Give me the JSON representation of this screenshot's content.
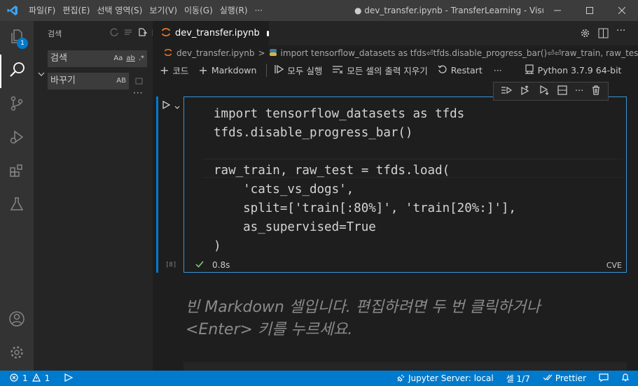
{
  "titlebar": {
    "menus": [
      "파일(F)",
      "편집(E)",
      "선택 영역(S)",
      "보기(V)",
      "이동(G)",
      "실행(R)",
      "···"
    ],
    "window_title": "● dev_transfer.ipynb - TransferLearning - Visual S..."
  },
  "activity": {
    "badge": "1"
  },
  "sidebar": {
    "header": "검색",
    "search_placeholder": "검색",
    "search_opts": [
      "Aa",
      "ab",
      ".*"
    ],
    "replace_placeholder": "바꾸기",
    "replace_opt": "AB",
    "more": "···"
  },
  "tab": {
    "label": "dev_transfer.ipynb"
  },
  "breadcrumb": {
    "file": "dev_transfer.ipynb",
    "sep": ">",
    "symbol": "import tensorflow_datasets as tfds⏎tfds.disable_progress_bar()⏎⏎raw_train, raw_test = tfds.load("
  },
  "toolbar": {
    "code": "코드",
    "markdown": "Markdown",
    "run_all": "모두 실행",
    "clear_outputs": "모든 셀의 출력 지우기",
    "restart": "Restart",
    "more": "···",
    "kernel": "Python 3.7.9 64-bit"
  },
  "cell": {
    "code_lines": [
      "import tensorflow_datasets as tfds",
      "tfds.disable_progress_bar()",
      "",
      "raw_train, raw_test = tfds.load(",
      "    'cats_vs_dogs',",
      "    split=['train[:80%]', 'train[20%:]'],",
      "    as_supervised=True",
      ")"
    ],
    "exec_count": "[8]",
    "duration": "0.8s",
    "lang": "CVE"
  },
  "markdown": {
    "placeholder_line1": "빈 Markdown 셀입니다. 편집하려면 두 번 클릭하거나",
    "placeholder_line2": "<Enter> 키를 누르세요."
  },
  "statusbar": {
    "errors": "1",
    "warnings": "1",
    "jupyter": "Jupyter Server: local",
    "cell_pos": "셀 1/7",
    "prettier": "Prettier"
  },
  "colors": {
    "accent": "#007acc",
    "activity": "#333333",
    "sidebar": "#252526",
    "editor": "#1e1e1e"
  }
}
